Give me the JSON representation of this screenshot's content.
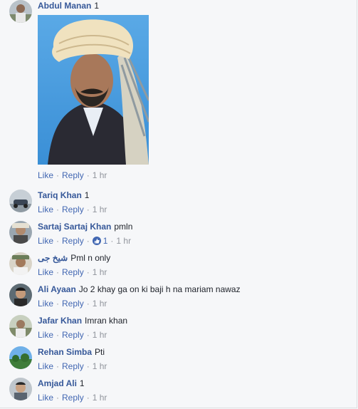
{
  "comments": [
    {
      "author": "Abdul Manan",
      "text": "1",
      "like": "Like",
      "reply": "Reply",
      "time": "1 hr",
      "has_photo": true
    },
    {
      "author": "Tariq Khan",
      "text": "1",
      "like": "Like",
      "reply": "Reply",
      "time": "1 hr"
    },
    {
      "author": "Sartaj Sartaj Khan",
      "text": "pmln",
      "like": "Like",
      "reply": "Reply",
      "reactions": "1",
      "time": "1 hr"
    },
    {
      "author": "شیخ جی",
      "text": "Pml n only",
      "like": "Like",
      "reply": "Reply",
      "time": "1 hr"
    },
    {
      "author": "Ali Ayaan",
      "text": "Jo 2 khay ga on ki baji h na mariam nawaz",
      "like": "Like",
      "reply": "Reply",
      "time": "1 hr"
    },
    {
      "author": "Jafar Khan",
      "text": "Imran khan",
      "like": "Like",
      "reply": "Reply",
      "time": "1 hr"
    },
    {
      "author": "Rehan Simba",
      "text": "Pti",
      "like": "Like",
      "reply": "Reply",
      "time": "1 hr"
    },
    {
      "author": "Amjad Ali",
      "text": "1",
      "like": "Like",
      "reply": "Reply",
      "time": "1 hr"
    }
  ],
  "colors": {
    "author": "#365899",
    "link": "#4267b2",
    "meta": "#90949c",
    "text": "#1d2129",
    "background": "#f6f7f9"
  },
  "icons": {
    "reaction": "like-reaction-icon"
  }
}
